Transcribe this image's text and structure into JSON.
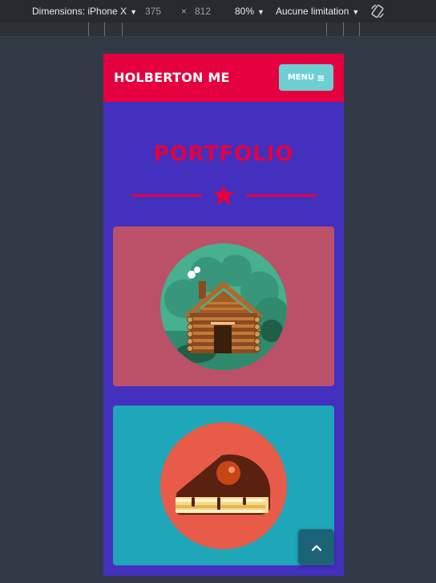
{
  "devtools": {
    "device_label": "Dimensions: iPhone X",
    "width": "375",
    "times": "×",
    "height": "812",
    "zoom": "80%",
    "throttle": "Aucune limitation",
    "rotate_icon": "rotate-icon"
  },
  "site": {
    "brand": "HOLBERTON ME",
    "menu_label": "MENU",
    "menu_icon": "hamburger-icon",
    "section_title": "PORTFOLIO",
    "divider_icon": "star-icon",
    "cards": [
      {
        "image": "log-cabin-illustration"
      },
      {
        "image": "cake-slice-illustration"
      }
    ],
    "scroll_top_icon": "chevron-up-icon"
  },
  "colors": {
    "header": "#e5003f",
    "page_bg": "#4330be",
    "accent": "#e5003f",
    "menu_btn": "#6ecfd3",
    "card1": "#bb5069",
    "card2": "#1fa6b8",
    "scroll_btn": "#1d6377"
  }
}
